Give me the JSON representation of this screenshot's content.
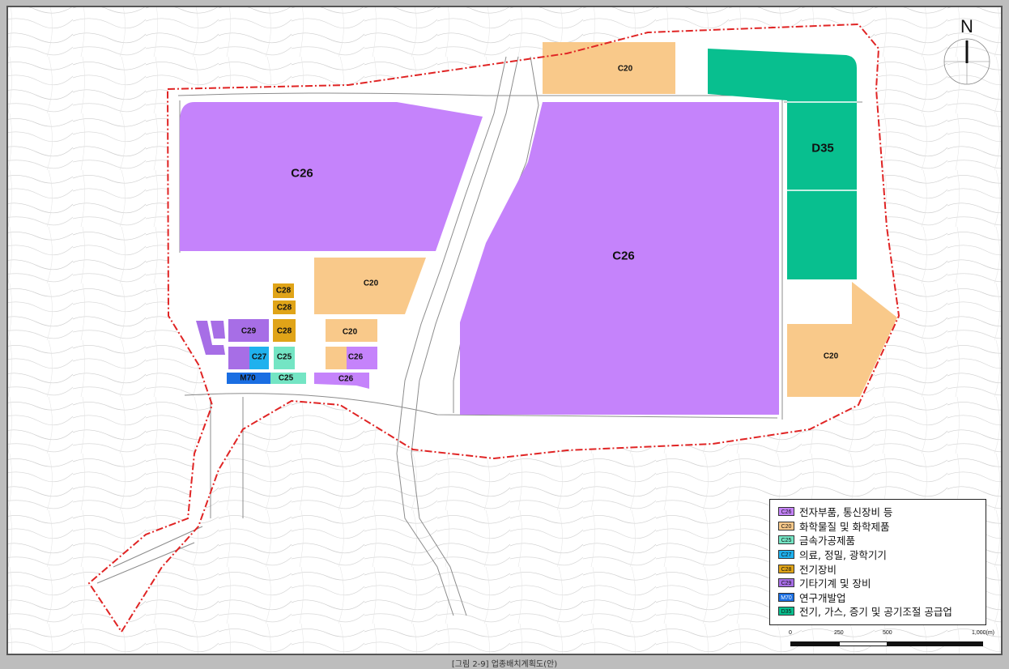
{
  "colors": {
    "C26": "#c583fb",
    "C20": "#f9c98a",
    "D35": "#08bf8f",
    "C28": "#e0a418",
    "C29": "#a76ee6",
    "C27": "#1fb1ee",
    "C25": "#74e5c4",
    "M70": "#1a6ee2",
    "boundary": "#e02424"
  },
  "map": {
    "labels": {
      "C26": "C26",
      "C20": "C20",
      "D35": "D35",
      "C28": "C28",
      "C29": "C29",
      "C27": "C27",
      "C25": "C25",
      "M70": "M70"
    }
  },
  "north_arrow": {
    "label": "N"
  },
  "legend": {
    "items": [
      {
        "code": "C26",
        "text": "전자부품, 통신장비 등"
      },
      {
        "code": "C20",
        "text": "화학물질 및 화학제품"
      },
      {
        "code": "C25",
        "text": "금속가공제품"
      },
      {
        "code": "C27",
        "text": "의료, 정밀, 광학기기"
      },
      {
        "code": "C28",
        "text": "전기장비"
      },
      {
        "code": "C29",
        "text": "기타기계 및 장비"
      },
      {
        "code": "M70",
        "text": "연구개발업"
      },
      {
        "code": "D35",
        "text": "전기, 가스, 증기 및 공기조절 공급업"
      }
    ]
  },
  "scale": {
    "ticks": [
      "0",
      "250",
      "500",
      "1,000(m)"
    ]
  },
  "caption": "[그림 2-9] 업종배치계획도(안)"
}
